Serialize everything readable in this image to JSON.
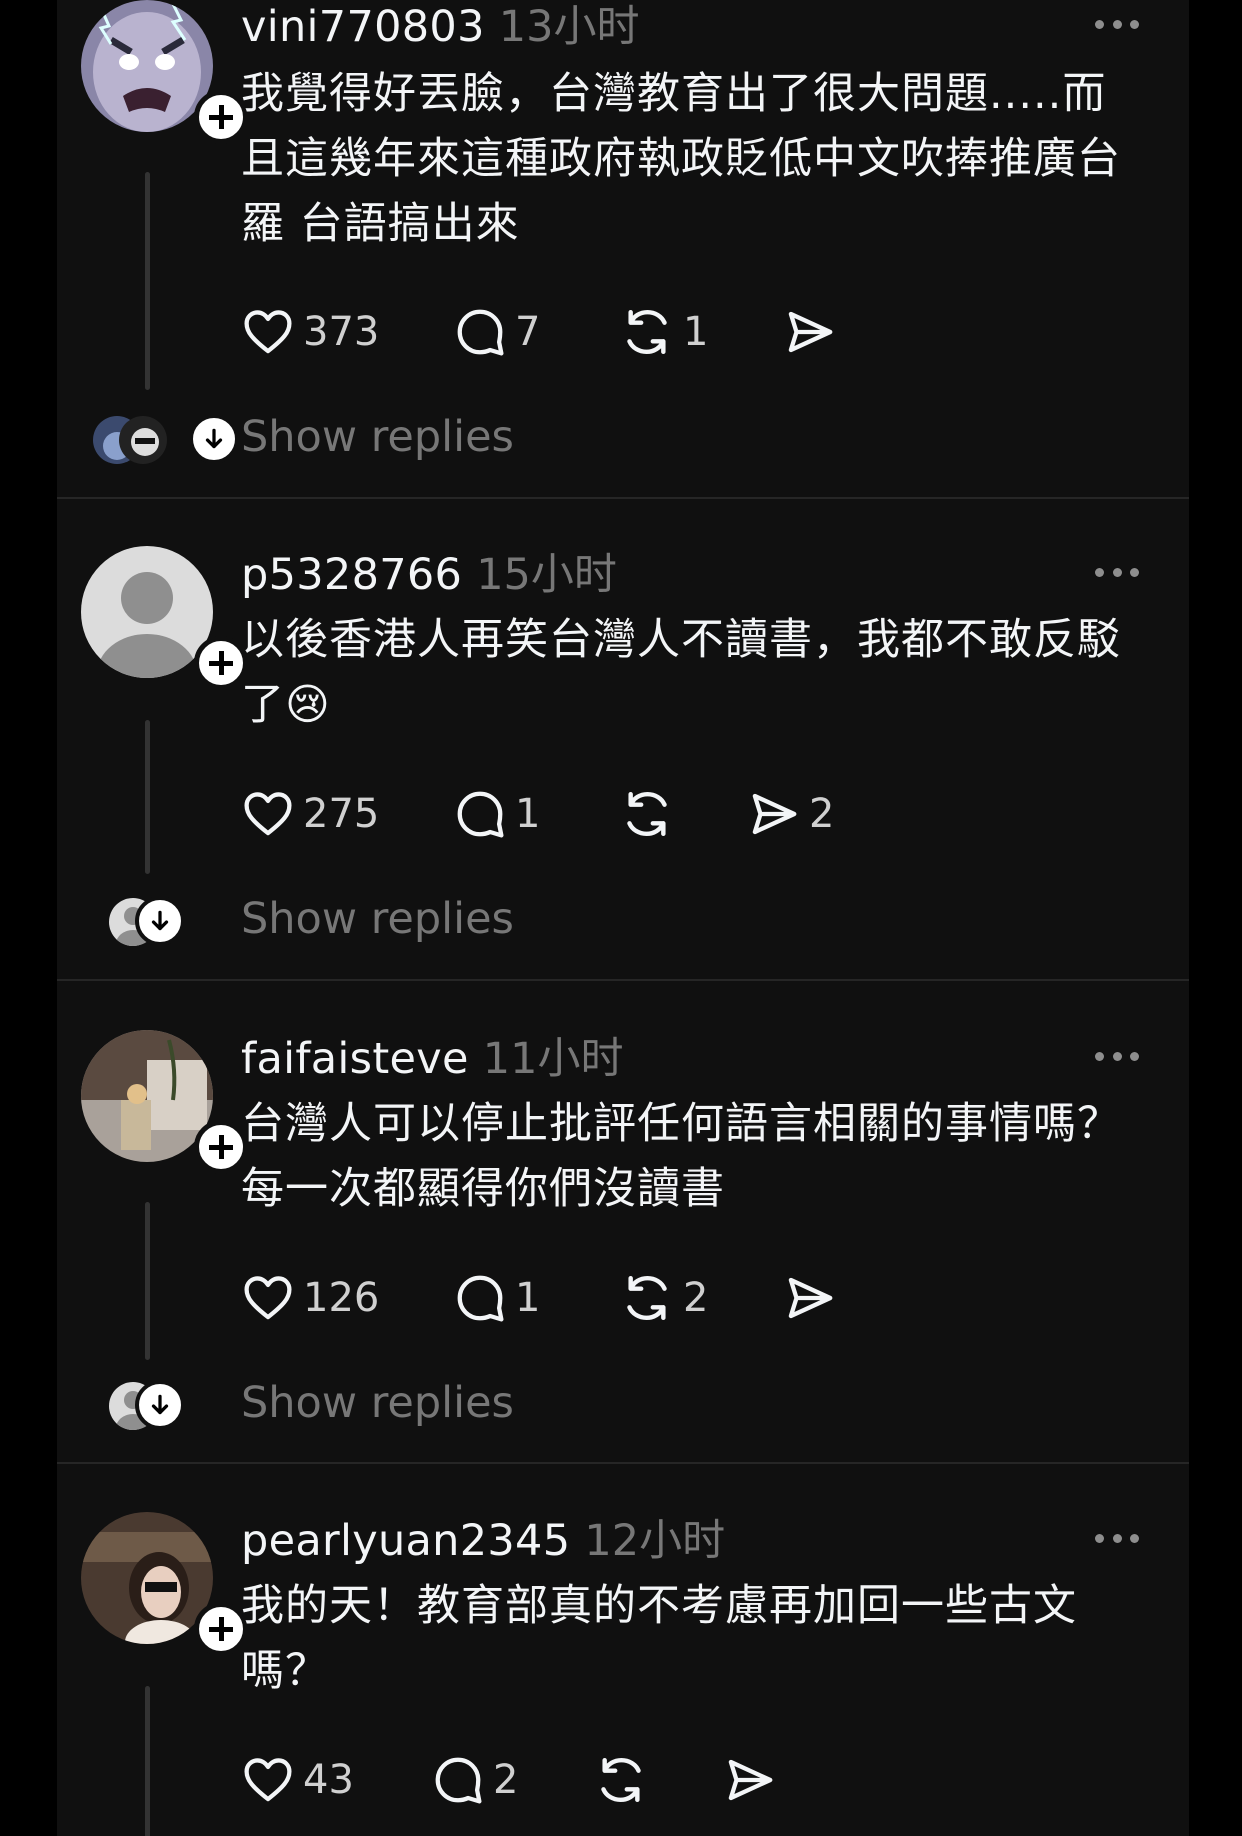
{
  "posts": [
    {
      "username": "vini770803",
      "time": "13小时",
      "text": "我覺得好丟臉，台灣教育出了很大問題.....而且這幾年來這種政府執政貶低中文吹捧推廣台羅 台語搞出來",
      "likes": "373",
      "replies": "7",
      "reposts": "1",
      "shares": "",
      "show_replies": "Show replies"
    },
    {
      "username": "p5328766",
      "time": "15小时",
      "text": "以後香港人再笑台灣人不讀書，我都不敢反駁了😢",
      "likes": "275",
      "replies": "1",
      "reposts": "",
      "shares": "2",
      "show_replies": "Show replies"
    },
    {
      "username": "faifaisteve",
      "time": "11小时",
      "text": "台灣人可以停止批評任何語言相關的事情嗎？每一次都顯得你們沒讀書",
      "likes": "126",
      "replies": "1",
      "reposts": "2",
      "shares": "",
      "show_replies": "Show replies"
    },
    {
      "username": "pearlyuan2345",
      "time": "12小时",
      "text": "我的天！教育部真的不考慮再加回一些古文嗎？",
      "likes": "43",
      "replies": "2",
      "reposts": "",
      "shares": ""
    }
  ],
  "icons": [
    "heart-icon",
    "comment-icon",
    "repost-icon",
    "share-icon",
    "more-icon",
    "follow-plus-icon",
    "expand-down-icon"
  ],
  "colors": {
    "background": "#101010",
    "text": "#f3f5f7",
    "muted": "#777777",
    "divider": "#262626"
  }
}
